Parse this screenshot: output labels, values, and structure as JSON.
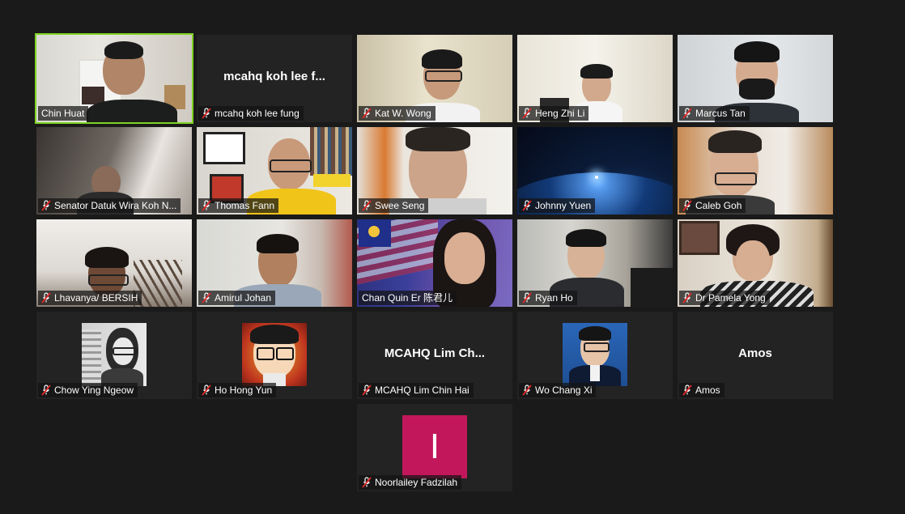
{
  "participants": [
    {
      "name": "Chin Huat",
      "muted": false
    },
    {
      "name": "mcahq koh lee fung",
      "display": "mcahq koh lee f...",
      "muted": true
    },
    {
      "name": "Kat W. Wong",
      "muted": true
    },
    {
      "name": "Heng Zhi Li",
      "muted": true
    },
    {
      "name": "Marcus Tan",
      "muted": true
    },
    {
      "name": "Senator Datuk Wira Koh N...",
      "muted": true
    },
    {
      "name": "Thomas Fann",
      "muted": true
    },
    {
      "name": "Swee Seng",
      "muted": true
    },
    {
      "name": "Johnny Yuen",
      "muted": true
    },
    {
      "name": "Caleb Goh",
      "muted": true
    },
    {
      "name": "Lhavanya/ BERSIH",
      "muted": true
    },
    {
      "name": "Amirul Johan",
      "muted": true
    },
    {
      "name": "Chan Quin Er 陈君儿",
      "muted": false
    },
    {
      "name": "Ryan Ho",
      "muted": true
    },
    {
      "name": "Dr Pamela Yong",
      "muted": true
    },
    {
      "name": "Chow Ying Ngeow",
      "muted": true
    },
    {
      "name": "Ho Hong Yun",
      "muted": true
    },
    {
      "name": "MCAHQ  Lim Chin Hai",
      "display": "MCAHQ   Lim Ch...",
      "muted": true
    },
    {
      "name": "Wo Chang Xi",
      "muted": true
    },
    {
      "name": "Amos",
      "display": "Amos",
      "muted": true
    },
    {
      "name": "Noorlailey Fadzilah",
      "avatar_letter": "I",
      "muted": true
    }
  ],
  "colors": {
    "active_speaker_border": "#7ed321",
    "muted_icon": "#e02828",
    "avatar_bg": "#c2185b"
  }
}
